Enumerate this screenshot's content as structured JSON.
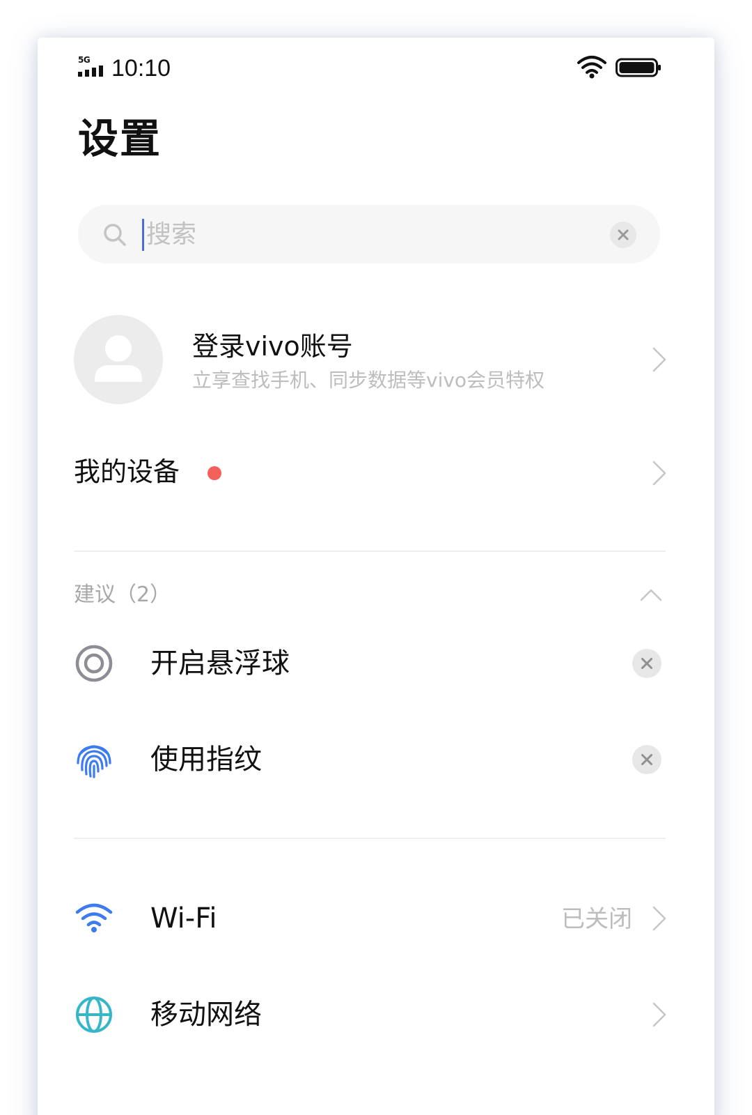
{
  "status_bar": {
    "network": "5G",
    "time": "10:10"
  },
  "page_title": "设置",
  "search": {
    "placeholder": "搜索",
    "value": ""
  },
  "account": {
    "title": "登录vivo账号",
    "subtitle": "立享查找手机、同步数据等vivo会员特权"
  },
  "my_devices": {
    "label": "我的设备",
    "badge_color": "#f4615a"
  },
  "suggestions": {
    "header": "建议（2）",
    "items": [
      {
        "label": "开启悬浮球",
        "icon": "floating-ball-icon"
      },
      {
        "label": "使用指纹",
        "icon": "fingerprint-icon"
      }
    ]
  },
  "settings_items": [
    {
      "label": "Wi-Fi",
      "value": "已关闭",
      "icon": "wifi-icon"
    },
    {
      "label": "移动网络",
      "value": "",
      "icon": "globe-icon"
    }
  ],
  "colors": {
    "accent_blue": "#3d7bf0",
    "globe_teal": "#37b6c8",
    "secondary_text": "#bdbdbd"
  }
}
